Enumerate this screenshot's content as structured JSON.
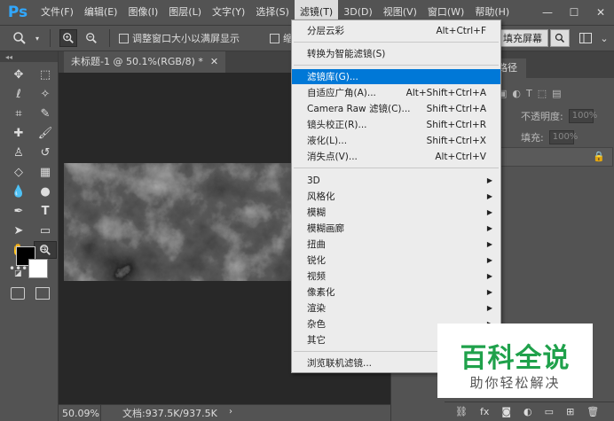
{
  "app": {
    "logo": "Ps"
  },
  "menubar": {
    "items": [
      "文件(F)",
      "编辑(E)",
      "图像(I)",
      "图层(L)",
      "文字(Y)",
      "选择(S)",
      "滤镜(T)",
      "3D(D)",
      "视图(V)",
      "窗口(W)",
      "帮助(H)"
    ],
    "active_index": 6
  },
  "window": {
    "minimize": "—",
    "restore": "☐",
    "close": "✕"
  },
  "options": {
    "check1": "调整窗口大小以满屏显示",
    "check2": "缩放所有",
    "fill_screen": "填充屏幕"
  },
  "document": {
    "tab_title": "未标题-1 @ 50.1%(RGB/8) *",
    "tab_close": "✕"
  },
  "status": {
    "zoom": "50.09%",
    "doc_info": "文档:937.5K/937.5K",
    "arrow": "›"
  },
  "panel": {
    "paths_tab": "路径",
    "opacity_label": "不透明度:",
    "opacity_value": "100%",
    "fill_label": "填充:",
    "fill_value": "100%"
  },
  "filter_menu": {
    "last_filter": {
      "label": "分层云彩",
      "shortcut": "Alt+Ctrl+F"
    },
    "smart": {
      "label": "转换为智能滤镜(S)"
    },
    "group1": [
      {
        "label": "滤镜库(G)...",
        "shortcut": ""
      },
      {
        "label": "自适应广角(A)...",
        "shortcut": "Alt+Shift+Ctrl+A"
      },
      {
        "label": "Camera Raw 滤镜(C)...",
        "shortcut": "Shift+Ctrl+A"
      },
      {
        "label": "镜头校正(R)...",
        "shortcut": "Shift+Ctrl+R"
      },
      {
        "label": "液化(L)...",
        "shortcut": "Shift+Ctrl+X"
      },
      {
        "label": "消失点(V)...",
        "shortcut": "Alt+Ctrl+V"
      }
    ],
    "submenus": [
      "3D",
      "风格化",
      "模糊",
      "模糊画廊",
      "扭曲",
      "锐化",
      "视频",
      "像素化",
      "渲染",
      "杂色",
      "其它"
    ],
    "browse": {
      "label": "浏览联机滤镜..."
    }
  },
  "watermark": {
    "title": "百科全说",
    "subtitle": "助你轻松解决"
  },
  "colors": {
    "highlight": "#0078d7",
    "watermark_green": "#1fa14b"
  }
}
